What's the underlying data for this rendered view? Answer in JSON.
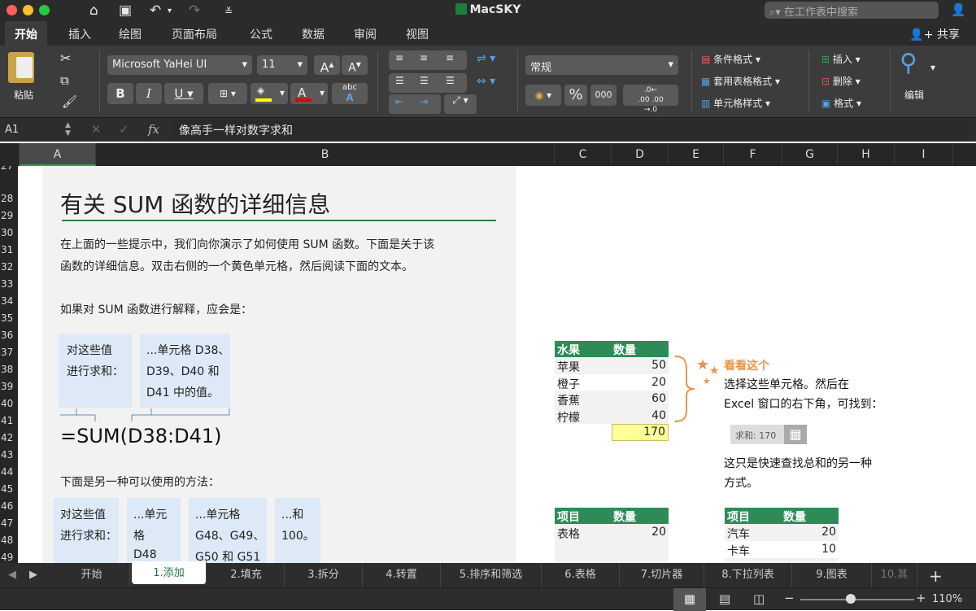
{
  "window": {
    "title": "MacSKY",
    "search_placeholder": "在工作表中搜索"
  },
  "ribbon_tabs": [
    "开始",
    "插入",
    "绘图",
    "页面布局",
    "公式",
    "数据",
    "审阅",
    "视图"
  ],
  "share_label": "共享",
  "ribbon": {
    "paste": "粘贴",
    "font_name": "Microsoft YaHei UI",
    "font_size": "11",
    "grow": "A",
    "shrink": "A",
    "bold": "B",
    "italic": "I",
    "underline": "U",
    "number_format": "常规",
    "percent": "%",
    "thousands": "000",
    "cond_format": "条件格式",
    "table_format": "套用表格格式",
    "cell_style": "单元格样式",
    "insert": "插入",
    "delete": "删除",
    "format": "格式",
    "edit": "编辑"
  },
  "formula_bar": {
    "cell_ref": "A1",
    "fx": "fx",
    "content": "像高手一样对数字求和"
  },
  "columns": [
    "A",
    "B",
    "C",
    "D",
    "E",
    "F",
    "G",
    "H",
    "I"
  ],
  "rows": [
    "28",
    "29",
    "30",
    "31",
    "32",
    "33",
    "34",
    "35",
    "36",
    "37",
    "38",
    "39",
    "40",
    "41",
    "42",
    "43",
    "44",
    "45",
    "46",
    "47",
    "48",
    "49"
  ],
  "info": {
    "heading": "有关 SUM 函数的详细信息",
    "p1a": "在上面的一些提示中，我们向你演示了如何使用 SUM 函数。下面是关于该",
    "p1b": "函数的详细信息。双击右侧的一个黄色单元格，然后阅读下面的文本。",
    "p2": "如果对 SUM 函数进行解释，应会是：",
    "box1a": "对这些值",
    "box1b": "进行求和：",
    "box2a": "...单元格 D38、",
    "box2b": "D39、D40 和",
    "box2c": "D41 中的值。",
    "formula": "=SUM(D38:D41)",
    "p3": "下面是另一种可以使用的方法：",
    "b3a": "对这些值",
    "b3b": "进行求和：",
    "b4a": "...单元",
    "b4b": "格",
    "b4c": "D48",
    "b5a": "...单元格",
    "b5b": "G48、G49、",
    "b5c": "G50 和 G51",
    "b6a": "...和",
    "b6b": "100。"
  },
  "table1": {
    "h1": "水果",
    "h2": "数量",
    "rows": [
      [
        "苹果",
        "50"
      ],
      [
        "橙子",
        "20"
      ],
      [
        "香蕉",
        "60"
      ],
      [
        "柠檬",
        "40"
      ]
    ],
    "total": "170"
  },
  "callout": {
    "title": "看看这个",
    "l1": "选择这些单元格。然后在",
    "l2": "Excel 窗口的右下角，可找到：",
    "badge": "求和: 170",
    "l3": "这只是快速查找总和的另一种",
    "l4": "方式。"
  },
  "table2": {
    "h1": "项目",
    "h2": "数量",
    "r1": [
      "表格",
      "20"
    ]
  },
  "table3": {
    "h1": "项目",
    "h2": "数量",
    "r1": [
      "汽车",
      "20"
    ],
    "r2": [
      "卡车",
      "10"
    ]
  },
  "sheet_tabs": [
    "开始",
    "1.添加",
    "2.填充",
    "3.拆分",
    "4.转置",
    "5.排序和筛选",
    "6.表格",
    "7.切片器",
    "8.下拉列表",
    "9.图表",
    "10.其"
  ],
  "zoom": "110%",
  "colors": {
    "green": "#2e8b57",
    "blue_box": "#dde9f6",
    "yellow": "#ffff99",
    "orange": "#e8964a"
  }
}
